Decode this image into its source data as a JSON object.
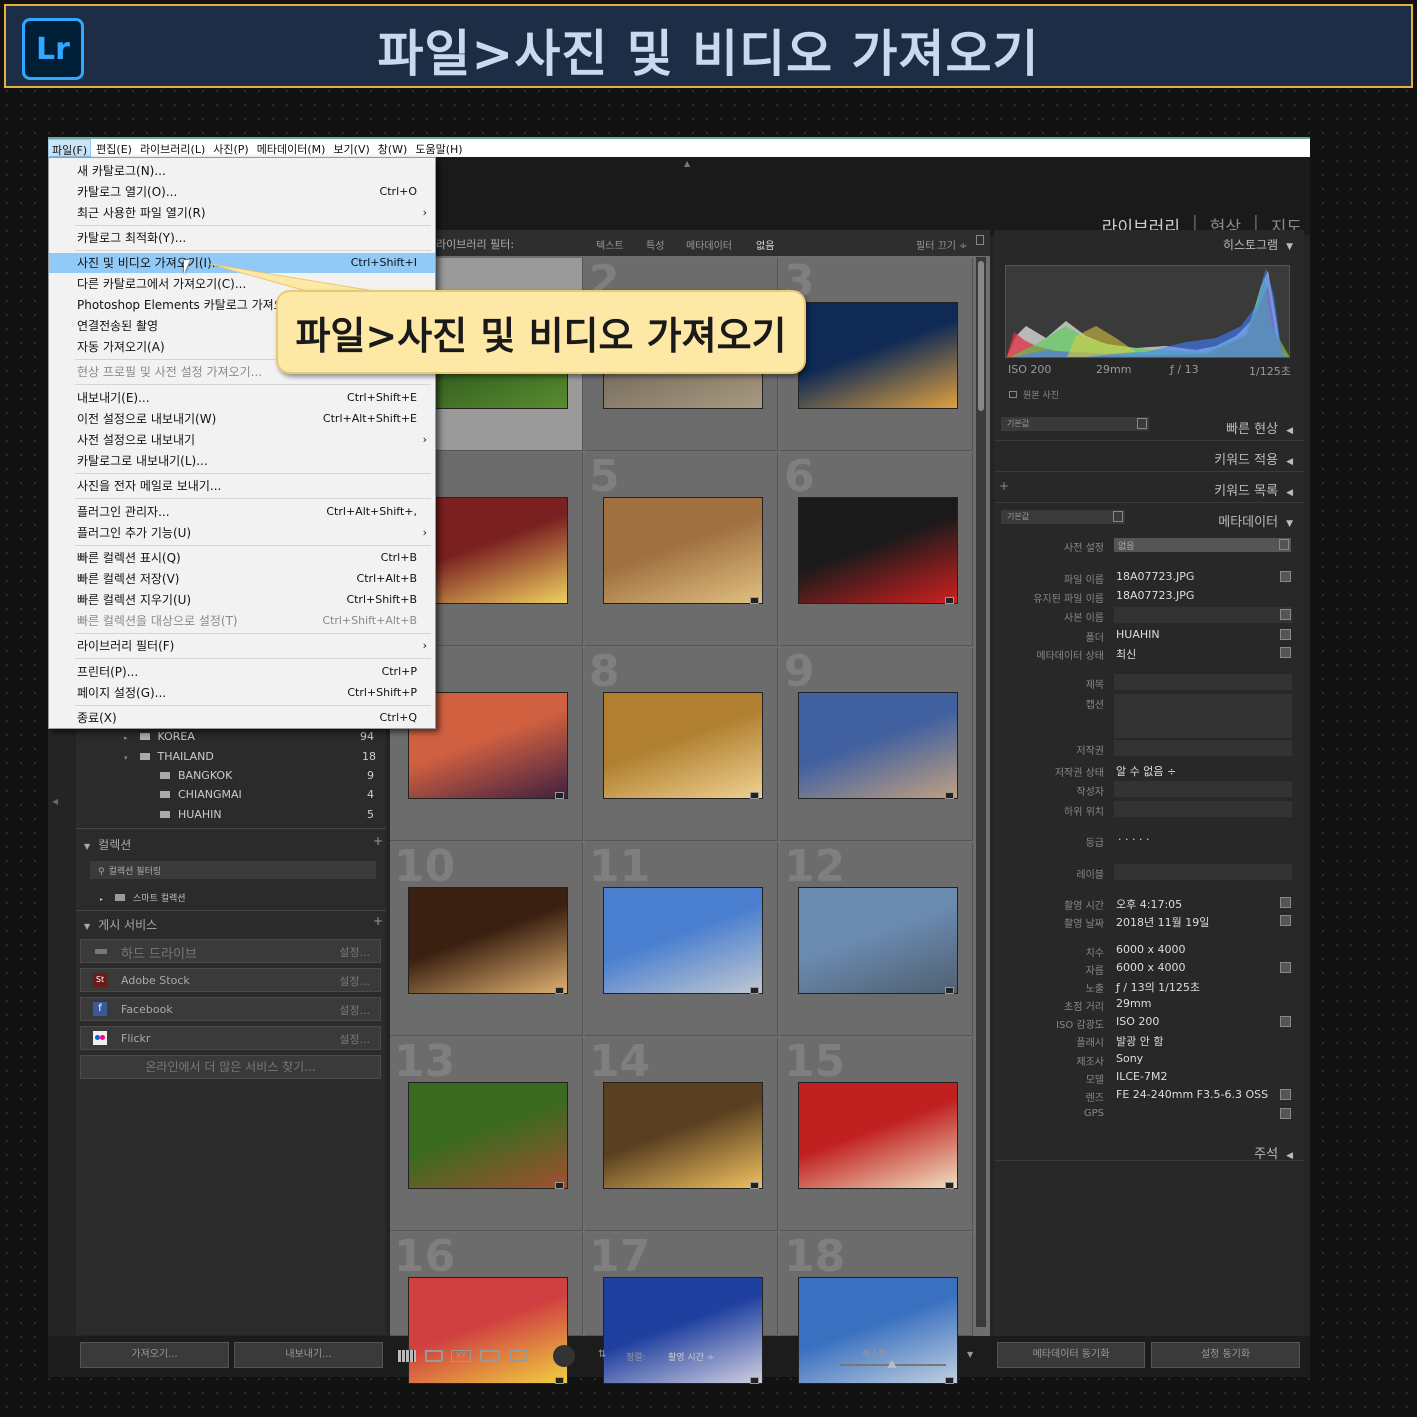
{
  "banner": {
    "logo": "Lr",
    "title": "파일>사진 및 비디오 가져오기"
  },
  "menubar": [
    "파일(F)",
    "편집(E)",
    "라이브러리(L)",
    "사진(P)",
    "메타데이터(M)",
    "보기(V)",
    "창(W)",
    "도움말(H)"
  ],
  "modules": {
    "library": "라이브러리",
    "develop": "현상",
    "map": "지도"
  },
  "filterbar": {
    "label": "라이브러리 필터:",
    "text": "텍스트",
    "attr": "특성",
    "meta": "메타데이터",
    "none": "없음",
    "off": "필터 끄기 ÷"
  },
  "menu": {
    "new_catalog": "새 카탈로그(N)...",
    "open_catalog": "카탈로그 열기(O)...",
    "open_catalog_sc": "Ctrl+O",
    "recent": "최근 사용한 파일 열기(R)",
    "optimize": "카탈로그 최적화(Y)...",
    "import": "사진 및 비디오 가져오기(I)...",
    "import_sc": "Ctrl+Shift+I",
    "import_catalog": "다른 카탈로그에서 가져오기(C)...",
    "pse": "Photoshop Elements 카탈로그 가져오기...",
    "tether": "연결전송된 촬영",
    "auto_import": "자동 가져오기(A)",
    "profiles": "현상 프로필 및 사전 설정 가져오기...",
    "export": "내보내기(E)...",
    "export_sc": "Ctrl+Shift+E",
    "export_prev": "이전 설정으로 내보내기(W)",
    "export_prev_sc": "Ctrl+Alt+Shift+E",
    "export_preset": "사전 설정으로 내보내기",
    "export_catalog": "카탈로그로 내보내기(L)...",
    "email": "사진을 전자 메일로 보내기...",
    "plugin_mgr": "플러그인 관리자...",
    "plugin_mgr_sc": "Ctrl+Alt+Shift+,",
    "plugin_extra": "플러그인 추가 기능(U)",
    "qc_show": "빠른 컬렉션 표시(Q)",
    "qc_show_sc": "Ctrl+B",
    "qc_save": "빠른 컬렉션 저장(V)",
    "qc_save_sc": "Ctrl+Alt+B",
    "qc_clear": "빠른 컬렉션 지우기(U)",
    "qc_clear_sc": "Ctrl+Shift+B",
    "qc_target": "빠른 컬렉션을 대상으로 설정(T)",
    "qc_target_sc": "Ctrl+Shift+Alt+B",
    "lib_filter": "라이브러리 필터(F)",
    "print": "프린터(P)...",
    "print_sc": "Ctrl+P",
    "page_setup": "페이지 설정(G)...",
    "page_setup_sc": "Ctrl+Shift+P",
    "exit": "종료(X)",
    "exit_sc": "Ctrl+Q",
    "arrow": "›"
  },
  "callout": "파일>사진 및 비디오 가져오기",
  "folders": [
    {
      "name": "KOREA",
      "count": "94"
    },
    {
      "name": "THAILAND",
      "count": "18"
    },
    {
      "name": "BANGKOK",
      "count": "9"
    },
    {
      "name": "CHIANGMAI",
      "count": "4"
    },
    {
      "name": "HUAHIN",
      "count": "5"
    }
  ],
  "collections": {
    "title": "컬렉션",
    "filter": "컬렉션 필터링",
    "smart": "스마트 컬렉션",
    "plus": "+"
  },
  "publish": {
    "title": "게시 서비스",
    "plus": "+",
    "setup": "설정...",
    "services": [
      "하드 드라이브",
      "Adobe Stock",
      "Facebook",
      "Flickr"
    ],
    "more": "온라인에서 더 많은 서비스 찾기..."
  },
  "grid_numbers": [
    "1",
    "2",
    "3",
    "4",
    "5",
    "6",
    "7",
    "8",
    "9",
    "10",
    "11",
    "12",
    "13",
    "14",
    "15",
    "16",
    "17",
    "18"
  ],
  "right": {
    "histogram": "히스토그램",
    "iso": "ISO 200",
    "focal": "29mm",
    "aperture": "ƒ / 13",
    "shutter": "1/125초",
    "original": "원본 사진",
    "preset_default": "기본값",
    "quick_dev": "빠른 현상",
    "keywording": "키워드 적용",
    "keyword_list": "키워드 목록",
    "metadata": "메타데이터",
    "preset_lbl": "사전 설정",
    "preset_val": "없음",
    "fields": [
      {
        "label": "파일 이름",
        "value": "18A07723.JPG"
      },
      {
        "label": "유지된 파일 이름",
        "value": "18A07723.JPG"
      },
      {
        "label": "사본 이름",
        "value": ""
      },
      {
        "label": "폴더",
        "value": "HUAHIN"
      },
      {
        "label": "메타데이터 상태",
        "value": "최신"
      }
    ],
    "fields2": [
      {
        "label": "제목",
        "value": ""
      },
      {
        "label": "캡션",
        "value": ""
      },
      {
        "label": "저작권",
        "value": ""
      },
      {
        "label": "저작권 상태",
        "value": "알 수 없음 ÷"
      },
      {
        "label": "작성자",
        "value": ""
      },
      {
        "label": "하위 위치",
        "value": ""
      }
    ],
    "rating_lbl": "등급",
    "rating_val": "·  ·  ·  ·  ·",
    "label_lbl": "레이블",
    "exif": [
      {
        "label": "촬영 시간",
        "value": "오후 4:17:05"
      },
      {
        "label": "촬영 날짜",
        "value": "2018년 11월 19일"
      },
      {
        "label": "치수",
        "value": "6000 x 4000"
      },
      {
        "label": "자름",
        "value": "6000 x 4000"
      },
      {
        "label": "노출",
        "value": "ƒ / 13의 1/125초"
      },
      {
        "label": "초점 거리",
        "value": "29mm"
      },
      {
        "label": "ISO 감광도",
        "value": "ISO 200"
      },
      {
        "label": "플래시",
        "value": "발광 안 함"
      },
      {
        "label": "제조사",
        "value": "Sony"
      },
      {
        "label": "모델",
        "value": "ILCE-7M2"
      },
      {
        "label": "렌즈",
        "value": "FE 24-240mm F3.5-6.3 OSS"
      },
      {
        "label": "GPS",
        "value": ""
      }
    ],
    "comments": "주석"
  },
  "bottom": {
    "import": "가져오기...",
    "export": "내보내기...",
    "sort_lbl": "정렬:",
    "sort_val": "촬영 시간 ÷",
    "thumbs": "축소판",
    "sync_meta": "메타데이터 동기화",
    "sync_set": "설정 동기화"
  }
}
